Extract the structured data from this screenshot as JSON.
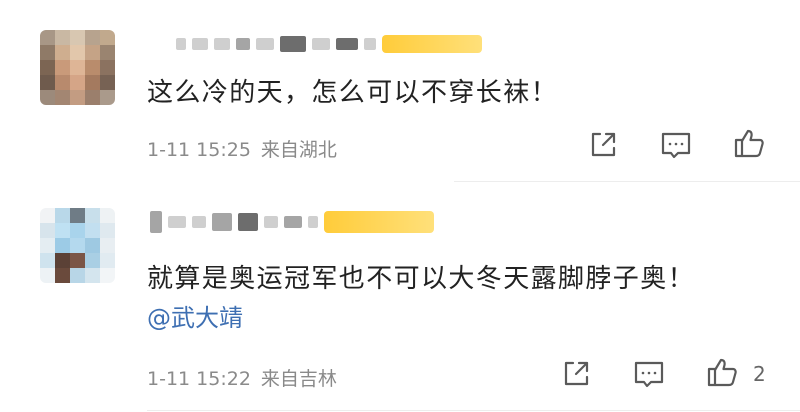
{
  "comments": [
    {
      "text": "这么冷的天，怎么可以不穿长袜！",
      "time": "1-11 15:25",
      "location": "来自湖北",
      "like_count": ""
    },
    {
      "text": "就算是奥运冠军也不可以大冬天露脚脖子奥！",
      "mention": "@武大靖",
      "time": "1-11 15:22",
      "location": "来自吉林",
      "like_count": "2"
    }
  ],
  "icons": [
    "share-icon",
    "comment-icon",
    "like-icon"
  ]
}
